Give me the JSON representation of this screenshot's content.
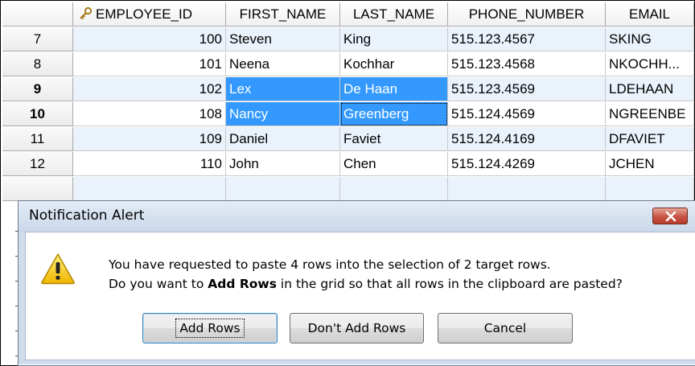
{
  "grid": {
    "columns": [
      "EMPLOYEE_ID",
      "FIRST_NAME",
      "LAST_NAME",
      "PHONE_NUMBER",
      "EMAIL"
    ],
    "rows": [
      {
        "num": "7",
        "id": "100",
        "first": "Steven",
        "last": "King",
        "phone": "515.123.4567",
        "email": "SKING"
      },
      {
        "num": "8",
        "id": "101",
        "first": "Neena",
        "last": "Kochhar",
        "phone": "515.123.4568",
        "email": "NKOCHH..."
      },
      {
        "num": "9",
        "id": "102",
        "first": "Lex",
        "last": "De Haan",
        "phone": "515.123.4569",
        "email": "LDEHAAN"
      },
      {
        "num": "10",
        "id": "108",
        "first": "Nancy",
        "last": "Greenberg",
        "phone": "515.124.4569",
        "email": "NGREENBE"
      },
      {
        "num": "11",
        "id": "109",
        "first": "Daniel",
        "last": "Faviet",
        "phone": "515.124.4169",
        "email": "DFAVIET"
      },
      {
        "num": "12",
        "id": "110",
        "first": "John",
        "last": "Chen",
        "phone": "515.124.4269",
        "email": "JCHEN"
      }
    ]
  },
  "dialog": {
    "title": "Notification Alert",
    "message_line1": "You have requested to paste 4 rows into the selection of 2 target rows.",
    "message_line2_prefix": "Do you want to ",
    "message_line2_bold": "Add Rows",
    "message_line2_suffix": " in the grid so that all rows in the clipboard are pasted?",
    "buttons": {
      "add_rows": "Add Rows",
      "dont_add_rows": "Don't Add Rows",
      "cancel": "Cancel"
    }
  },
  "colors": {
    "selection": "#3399ff",
    "row_highlight": "#eaf2fb",
    "dialog_frame": "#cfdcec",
    "close_button": "#c75444"
  },
  "icons": {
    "primary_key": "key-icon",
    "warning": "warning-icon",
    "close": "close-icon"
  }
}
